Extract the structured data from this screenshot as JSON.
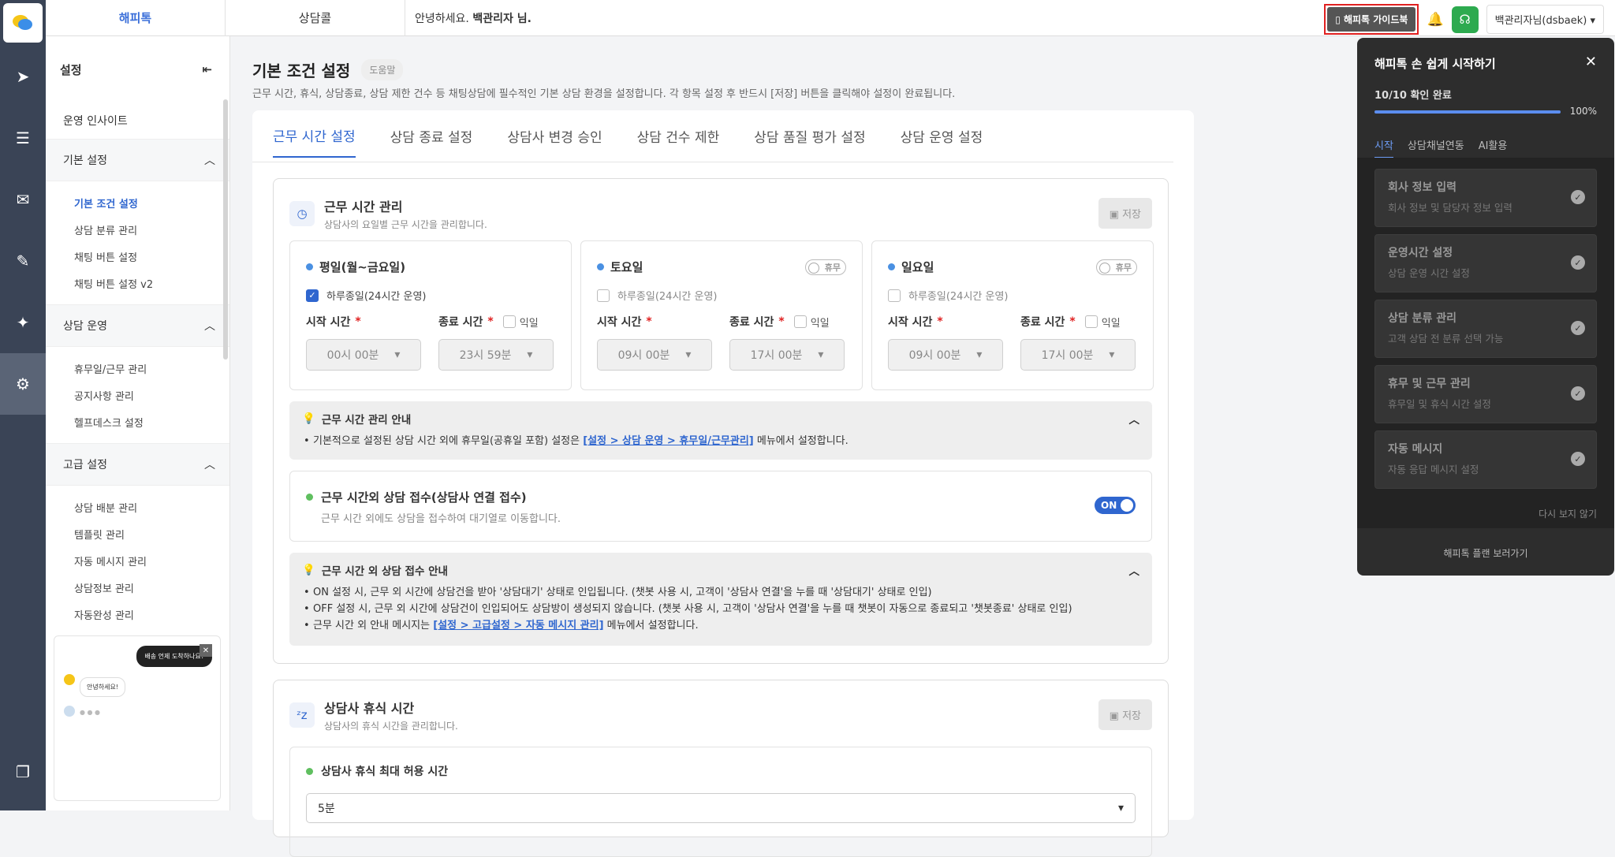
{
  "topbar": {
    "tab_active": "해피톡",
    "tab_2": "상담콜",
    "greet_prefix": "안녕하세요.",
    "greet_name": "백관리자 님.",
    "guide_button": "해피톡 가이드북",
    "user": "백관리자님(dsbaek)"
  },
  "sidebar": {
    "title": "설정",
    "insight": "운영 인사이트",
    "groups": [
      {
        "label": "기본 설정",
        "items": [
          "기본 조건 설정",
          "상담 분류 관리",
          "채팅 버튼 설정",
          "채팅 버튼 설정 v2"
        ]
      },
      {
        "label": "상담 운영",
        "items": [
          "휴무일/근무 관리",
          "공지사항 관리",
          "헬프데스크 설정"
        ]
      },
      {
        "label": "고급 설정",
        "items": [
          "상담 배분 관리",
          "템플릿 관리",
          "자동 메시지 관리",
          "상담정보 관리",
          "자동완성 관리"
        ]
      }
    ],
    "preview": {
      "bubble_dark": "배송 언제 도착하나요?",
      "bubble_light": "안녕하세요!"
    }
  },
  "page": {
    "title": "기본 조건 설정",
    "help": "도움말",
    "desc": "근무 시간, 휴식, 상담종료, 상담 제한 건수 등 채팅상담에 필수적인 기본 상담 환경을 설정합니다. 각 항목 설정 후 반드시 [저장] 버튼을 클릭해야 설정이 완료됩니다.",
    "tabs": [
      "근무 시간 설정",
      "상담 종료 설정",
      "상담사 변경 승인",
      "상담 건수 제한",
      "상담 품질 평가 설정",
      "상담 운영 설정"
    ]
  },
  "worktime": {
    "title": "근무 시간 관리",
    "subtitle": "상담사의 요일별 근무 시간을 관리합니다.",
    "save": "저장",
    "allday": "하루종일(24시간 운영)",
    "start_label": "시작 시간",
    "end_label": "종료 시간",
    "nextday": "익일",
    "rest": "휴무",
    "days": [
      {
        "name": "평일(월~금요일)",
        "start": "00시 00분",
        "end": "23시 59분",
        "allday_checked": true
      },
      {
        "name": "토요일",
        "start": "09시 00분",
        "end": "17시 00분",
        "allday_checked": false
      },
      {
        "name": "일요일",
        "start": "09시 00분",
        "end": "17시 00분",
        "allday_checked": false
      }
    ],
    "guide": {
      "title": "근무 시간 관리 안내",
      "pre": "기본적으로 설정된 상담 시간 외에 휴무일(공휴일 포함) 설정은 ",
      "link": "[설정 > 상담 운영 > 휴무일/근무관리]",
      "post": " 메뉴에서 설정합니다."
    },
    "after": {
      "title": "근무 시간외 상담 접수(상담사 연결 접수)",
      "desc": "근무 시간 외에도 상담을 접수하여 대기열로 이동합니다.",
      "toggle": "ON"
    },
    "after_guide": {
      "title": "근무 시간 외 상담 접수 안내",
      "l1": "ON 설정 시, 근무 외 시간에 상담건을 받아 '상담대기' 상태로 인입됩니다. (챗봇 사용 시, 고객이 '상담사 연결'을 누를 때 '상담대기' 상태로 인입)",
      "l2": "OFF 설정 시, 근무 외 시간에 상담건이 인입되어도 상담방이 생성되지 않습니다. (챗봇 사용 시, 고객이 '상담사 연결'을 누를 때 챗봇이 자동으로 종료되고 '챗봇종료' 상태로 인입)",
      "l3_pre": "근무 시간 외 안내 메시지는 ",
      "l3_link": "[설정 > 고급설정 > 자동 메시지 관리]",
      "l3_post": " 메뉴에서 설정합니다."
    }
  },
  "rest": {
    "title": "상담사 휴식 시간",
    "subtitle": "상담사의 휴식 시간을 관리합니다.",
    "save": "저장",
    "max_label": "상담사 휴식 최대 허용 시간",
    "max_value": "5분"
  },
  "overlay": {
    "title": "해피톡 손 쉽게 시작하기",
    "progress": "10/10 확인 완료",
    "percent": "100%",
    "progress_value": 1.0,
    "tabs": [
      "시작",
      "상담채널연동",
      "AI활용"
    ],
    "items": [
      {
        "t": "회사 정보 입력",
        "s": "회사 정보 및 담당자 정보 입력"
      },
      {
        "t": "운영시간 설정",
        "s": "상담 운영 시간 설정"
      },
      {
        "t": "상담 분류 관리",
        "s": "고객 상담 전 분류 선택 가능"
      },
      {
        "t": "휴무 및 근무 관리",
        "s": "휴무일 및 휴식 시간 설정"
      },
      {
        "t": "자동 메시지",
        "s": "자동 응답 메시지 설정"
      }
    ],
    "hide": "다시 보지 않기",
    "plan": "해피톡 플랜 보러가기"
  }
}
